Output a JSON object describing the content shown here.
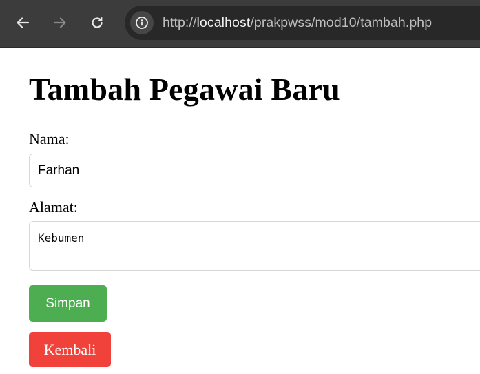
{
  "browser": {
    "url_prefix": "http://",
    "url_host": "localhost",
    "url_path": "/prakpwss/mod10/tambah.php",
    "icons": {
      "back": "arrow-left-icon",
      "forward": "arrow-right-icon",
      "reload": "reload-icon",
      "site_info": "info-icon"
    }
  },
  "page": {
    "title": "Tambah Pegawai Baru",
    "form": {
      "nama_label": "Nama:",
      "nama_value": "Farhan",
      "alamat_label": "Alamat:",
      "alamat_value": "Kebumen",
      "submit_label": "Simpan",
      "back_label": "Kembali"
    }
  },
  "colors": {
    "submit_button": "#4cae50",
    "back_button": "#f0423a",
    "toolbar": "#3c3c3c"
  }
}
